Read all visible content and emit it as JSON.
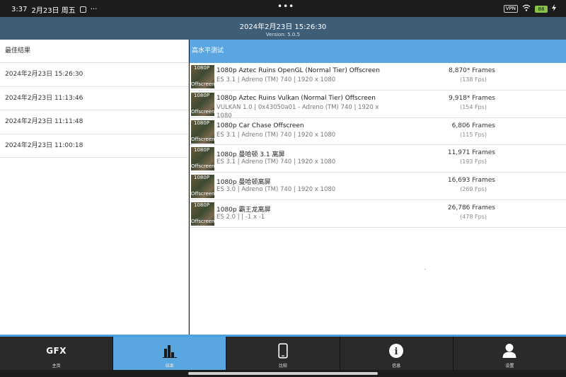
{
  "statusbar": {
    "time": "3:37",
    "date": "2月23日 周五",
    "more": "···",
    "center_dots": "•••",
    "vpn": "VPN",
    "battery": "88"
  },
  "header": {
    "title": "2024年2月23日 15:26:30",
    "version": "Version: 5.0.5"
  },
  "left": {
    "title": "最佳结果",
    "items": [
      "2024年2月23日 15:26:30",
      "2024年2月23日 11:13:46",
      "2024年2月23日 11:11:48",
      "2024年2月23日 11:00:18"
    ]
  },
  "right": {
    "title": "高水平测试",
    "tests": [
      {
        "thumb_top": "1080P",
        "thumb_bottom": "Offscreen",
        "name": "1080p Aztec Ruins OpenGL (Normal Tier) Offscreen",
        "sub": "ES 3.1 | Adreno (TM) 740 | 1920 x 1080",
        "score": "8,870* Frames",
        "fps": "(138 Fps)"
      },
      {
        "thumb_top": "1080P",
        "thumb_bottom": "Offscreen",
        "name": "1080p Aztec Ruins Vulkan (Normal Tier) Offscreen",
        "sub": "VULKAN 1.0 | 0x43050a01 - Adreno (TM) 740 | 1920 x 1080",
        "score": "9,918* Frames",
        "fps": "(154 Fps)"
      },
      {
        "thumb_top": "1080P",
        "thumb_bottom": "Offscreen",
        "name": "1080p Car Chase Offscreen",
        "sub": "ES 3.1 | Adreno (TM) 740 | 1920 x 1080",
        "score": "6,806 Frames",
        "fps": "(115 Fps)"
      },
      {
        "thumb_top": "1080P",
        "thumb_bottom": "Offscreen",
        "name": "1080p 曼哈顿 3.1 离屏",
        "sub": "ES 3.1 | Adreno (TM) 740 | 1920 x 1080",
        "score": "11,971 Frames",
        "fps": "(193 Fps)"
      },
      {
        "thumb_top": "1080P",
        "thumb_bottom": "Offscreen",
        "name": "1080p 曼哈顿离屏",
        "sub": "ES 3.0 | Adreno (TM) 740 | 1920 x 1080",
        "score": "16,693 Frames",
        "fps": "(269 Fps)"
      },
      {
        "thumb_top": "1080P",
        "thumb_bottom": "Offscreen",
        "name": "1080p 霸王龙离屏",
        "sub": "ES 2.0 |  | -1 x -1",
        "score": "26,786 Frames",
        "fps": "(478 Fps)"
      }
    ]
  },
  "tabs": [
    {
      "label": "主页",
      "icon": "gfx-logo-icon",
      "logo": "GFX"
    },
    {
      "label": "结果",
      "icon": "bar-chart-icon"
    },
    {
      "label": "比较",
      "icon": "phone-icon"
    },
    {
      "label": "信息",
      "icon": "info-icon",
      "glyph": "i"
    },
    {
      "label": "设置",
      "icon": "user-icon"
    }
  ],
  "colors": {
    "header": "#3e5e78",
    "accent": "#5aa6e0",
    "tabbar": "#2a2a2a"
  }
}
